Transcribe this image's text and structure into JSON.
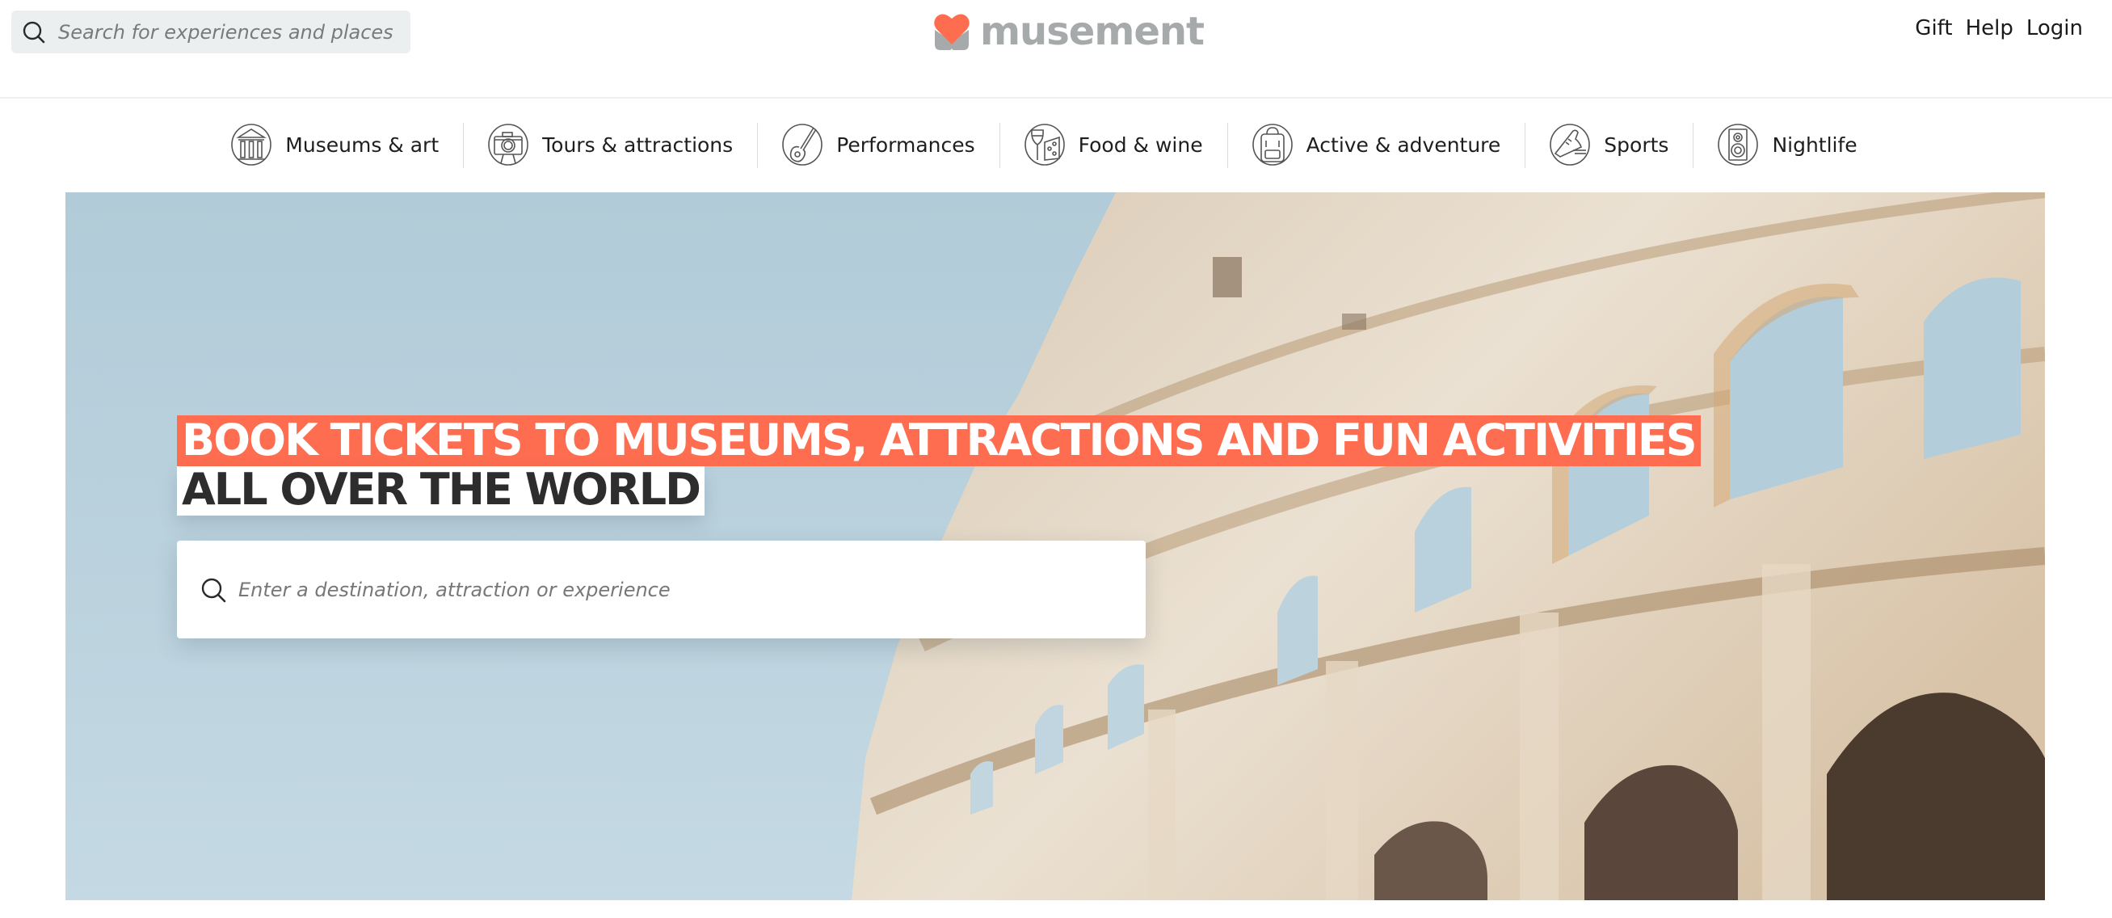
{
  "header": {
    "search": {
      "placeholder": "Search for experiences and places",
      "icon": "search-icon"
    },
    "logo": {
      "text": "musement",
      "icon": "heart-logo-icon",
      "colors": {
        "heart": "#fe6d50",
        "base": "#a6aaab"
      }
    },
    "links": [
      {
        "label": "Gift"
      },
      {
        "label": "Help"
      },
      {
        "label": "Login"
      }
    ]
  },
  "categories": [
    {
      "label": "Museums & art",
      "icon": "museum-icon"
    },
    {
      "label": "Tours & attractions",
      "icon": "camera-icon"
    },
    {
      "label": "Performances",
      "icon": "guitar-icon"
    },
    {
      "label": "Food & wine",
      "icon": "wine-cheese-icon"
    },
    {
      "label": "Active & adventure",
      "icon": "backpack-icon"
    },
    {
      "label": "Sports",
      "icon": "sneaker-icon"
    },
    {
      "label": "Nightlife",
      "icon": "speaker-icon"
    }
  ],
  "hero": {
    "headline_line1": "BOOK TICKETS TO MUSEUMS, ATTRACTIONS AND FUN ACTIVITIES",
    "headline_line2": "ALL OVER THE WORLD",
    "search": {
      "placeholder": "Enter a destination, attraction or experience",
      "icon": "search-icon"
    },
    "image": "colosseum-photo",
    "colors": {
      "accent": "#fe6d50",
      "sky": "#b6cfdb",
      "stone": "#e2d6c6"
    }
  }
}
